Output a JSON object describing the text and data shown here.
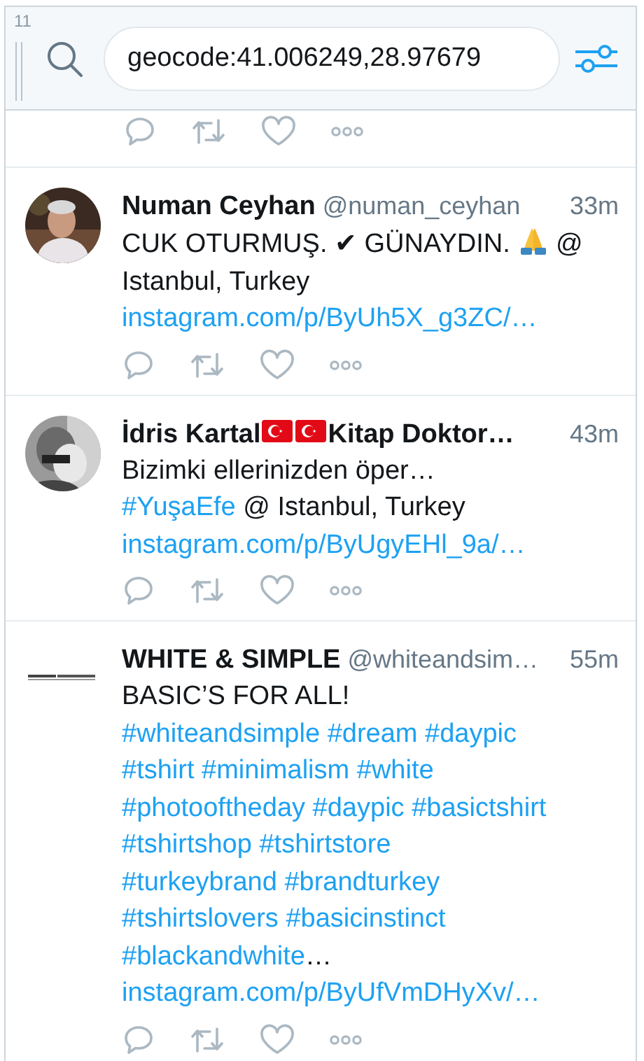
{
  "search": {
    "counter": "11",
    "value": "geocode:41.006249,28.97679"
  },
  "tweets": [
    {
      "kind": "cut"
    },
    {
      "kind": "full",
      "name": [
        {
          "kind": "text",
          "text": "Numan Ceyhan"
        }
      ],
      "handle": "@numan_ceyhan",
      "time": "33m",
      "body": [
        {
          "kind": "text",
          "text": "CUK OTURMUŞ. ✔ GÜNAYDIN."
        },
        {
          "kind": "emoji"
        },
        {
          "kind": "text",
          "text": "@"
        },
        {
          "kind": "text",
          "text": "Istanbul, Turkey"
        },
        {
          "kind": "link",
          "text": "instagram.com/p/ByUh5X_g3ZC/…"
        }
      ]
    },
    {
      "kind": "full",
      "name": [
        {
          "kind": "text",
          "text": "İdris Kartal"
        },
        {
          "kind": "flag"
        },
        {
          "kind": "flag"
        },
        {
          "kind": "text",
          "text": "Kitap Doktor…"
        }
      ],
      "time": "43m",
      "body": [
        {
          "kind": "text",
          "text": "Bizimki ellerinizden öper…"
        },
        {
          "kind": "break"
        },
        {
          "kind": "hashtag",
          "text": "#YuşaEfe"
        },
        {
          "kind": "text",
          "text": "@ Istanbul, Turkey"
        },
        {
          "kind": "link",
          "text": "instagram.com/p/ByUgyEHl_9a/…"
        }
      ]
    },
    {
      "kind": "full",
      "name": [
        {
          "kind": "text",
          "text": "WHITE & SIMPLE"
        }
      ],
      "handle": "@whiteandsim…",
      "time": "55m",
      "body": [
        {
          "kind": "text",
          "text": "BASIC’S FOR ALL!"
        },
        {
          "kind": "break"
        },
        {
          "kind": "hashtag",
          "text": "#whiteandsimple"
        },
        {
          "kind": "hashtag",
          "text": "#dream"
        },
        {
          "kind": "hashtag",
          "text": "#daypic"
        },
        {
          "kind": "break"
        },
        {
          "kind": "hashtag",
          "text": "#tshirt"
        },
        {
          "kind": "hashtag",
          "text": "#minimalism"
        },
        {
          "kind": "hashtag",
          "text": "#white"
        },
        {
          "kind": "break"
        },
        {
          "kind": "hashtag",
          "text": "#photooftheday"
        },
        {
          "kind": "hashtag",
          "text": "#daypic"
        },
        {
          "kind": "hashtag",
          "text": "#basictshirt"
        },
        {
          "kind": "break"
        },
        {
          "kind": "hashtag",
          "text": "#tshirtshop"
        },
        {
          "kind": "hashtag",
          "text": "#tshirtstore"
        },
        {
          "kind": "break"
        },
        {
          "kind": "hashtag",
          "text": "#turkeybrand"
        },
        {
          "kind": "hashtag",
          "text": "#brandturkey"
        },
        {
          "kind": "break"
        },
        {
          "kind": "hashtag",
          "text": "#tshirtslovers"
        },
        {
          "kind": "hashtag",
          "text": "#basicinstinct"
        },
        {
          "kind": "break"
        },
        {
          "kind": "hashtag",
          "text": "#blackandwhite"
        },
        {
          "kind": "ellipsis",
          "text": "…"
        },
        {
          "kind": "link",
          "text": "instagram.com/p/ByUfVmDHyXv/…"
        }
      ]
    }
  ]
}
